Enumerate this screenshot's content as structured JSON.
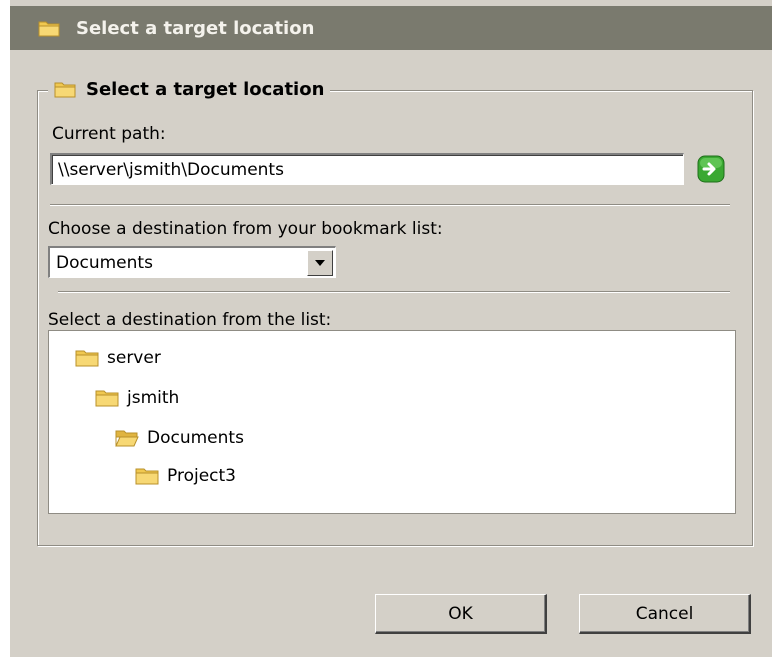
{
  "window": {
    "title": "Select a target location"
  },
  "group": {
    "title": "Select a target location"
  },
  "current_path": {
    "label": "Current path:",
    "value": "\\\\server\\jsmith\\Documents"
  },
  "bookmark": {
    "label": "Choose a destination from your bookmark list:",
    "selected": "Documents"
  },
  "tree": {
    "label": "Select a destination from the list:",
    "nodes": [
      {
        "label": "server",
        "icon": "folder-closed-icon"
      },
      {
        "label": "jsmith",
        "icon": "folder-closed-icon"
      },
      {
        "label": "Documents",
        "icon": "folder-open-icon"
      },
      {
        "label": "Project3",
        "icon": "folder-closed-icon"
      }
    ]
  },
  "buttons": {
    "ok": "OK",
    "cancel": "Cancel"
  },
  "colors": {
    "titlebar": "#7a7a6e",
    "dialog_bg": "#d4d0c8",
    "folder": "#f0c850",
    "go_button": "#3aa832"
  }
}
